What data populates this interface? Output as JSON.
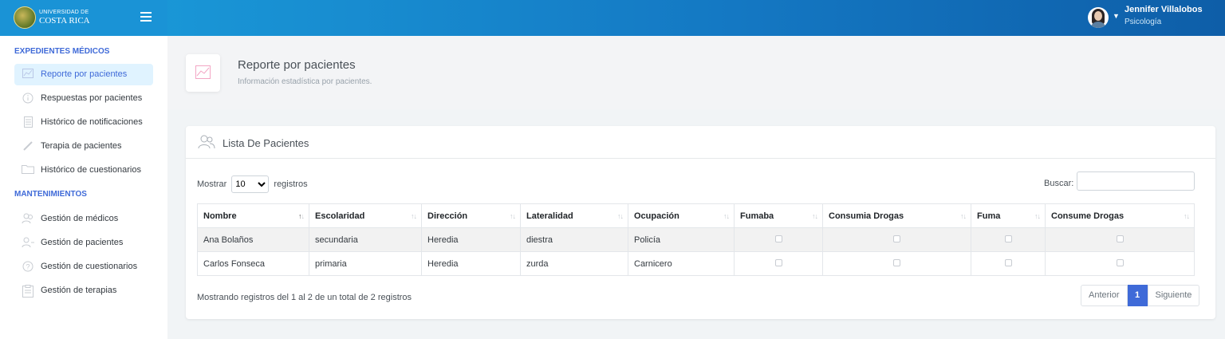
{
  "brand": {
    "line1": "UNIVERSIDAD DE",
    "line2": "COSTA RICA"
  },
  "user": {
    "name": "Jennifer Villalobos",
    "role": "Psicología"
  },
  "sidebar": {
    "sections": [
      {
        "heading": "EXPEDIENTES MÉDICOS"
      },
      {
        "heading": "MANTENIMIENTOS"
      }
    ],
    "items": [
      {
        "label": "Reporte por pacientes",
        "icon": "chart-line-icon",
        "active": true
      },
      {
        "label": "Respuestas por pacientes",
        "icon": "info-circle-icon"
      },
      {
        "label": "Histórico de notificaciones",
        "icon": "document-icon"
      },
      {
        "label": "Terapia de pacientes",
        "icon": "pencil-icon"
      },
      {
        "label": "Histórico de cuestionarios",
        "icon": "folder-icon"
      },
      {
        "label": "Gestión de médicos",
        "icon": "users-icon"
      },
      {
        "label": "Gestión de pacientes",
        "icon": "user-add-icon"
      },
      {
        "label": "Gestión de cuestionarios",
        "icon": "question-circle-icon"
      },
      {
        "label": "Gestión de terapias",
        "icon": "clipboard-icon"
      }
    ]
  },
  "page": {
    "title": "Reporte por pacientes",
    "subtitle": "Información estadística por pacientes."
  },
  "card": {
    "title": "Lista De Pacientes",
    "show_label": "Mostrar",
    "show_value": "10",
    "records_label": "registros",
    "search_label": "Buscar:",
    "search_value": "",
    "columns": [
      "Nombre",
      "Escolaridad",
      "Dirección",
      "Lateralidad",
      "Ocupación",
      "Fumaba",
      "Consumia Drogas",
      "Fuma",
      "Consume Drogas"
    ],
    "rows": [
      {
        "nombre": "Ana Bolaños",
        "escolaridad": "secundaria",
        "direccion": "Heredia",
        "lateralidad": "diestra",
        "ocupacion": "Policía",
        "fumaba": false,
        "consumia": false,
        "fuma": false,
        "consume": false
      },
      {
        "nombre": "Carlos Fonseca",
        "escolaridad": "primaria",
        "direccion": "Heredia",
        "lateralidad": "zurda",
        "ocupacion": "Carnicero",
        "fumaba": false,
        "consumia": false,
        "fuma": false,
        "consume": false
      }
    ],
    "info": "Mostrando registros del 1 al 2 de un total de 2 registros",
    "pagination": {
      "prev": "Anterior",
      "current": "1",
      "next": "Siguiente"
    }
  },
  "colors": {
    "accent": "#3f6ad8",
    "topbar": "#1478c3",
    "active_bg": "#e0f3ff"
  }
}
